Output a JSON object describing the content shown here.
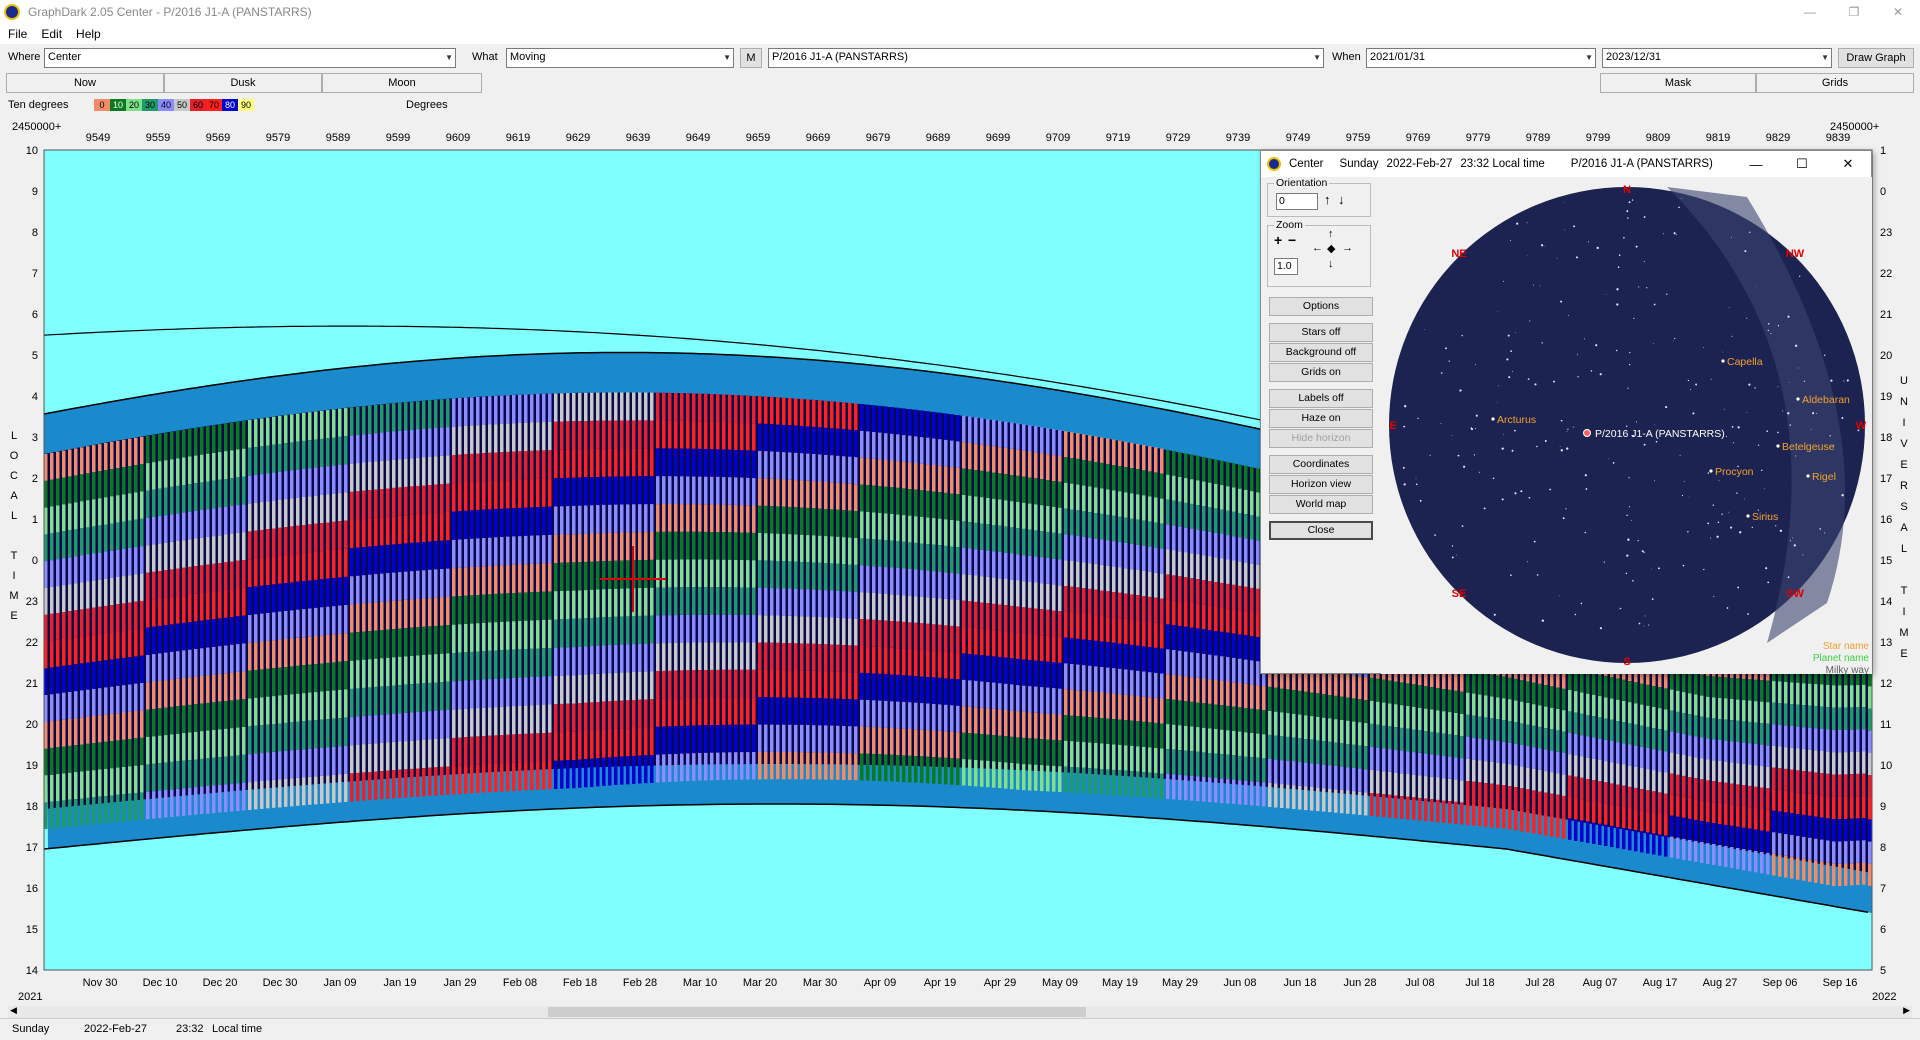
{
  "window": {
    "title": "GraphDark 2.05  Center  -  P/2016 J1-A (PANSTARRS)"
  },
  "menu": [
    "File",
    "Edit",
    "Help"
  ],
  "toolbar": {
    "where_label": "Where",
    "where_value": "Center",
    "what_label": "What",
    "what_value": "Moving",
    "m_button": "M",
    "object_value": "P/2016 J1-A (PANSTARRS)",
    "when_label": "When",
    "start_date": "2021/01/31",
    "end_date": "2023/12/31",
    "draw_button": "Draw Graph"
  },
  "tabs": {
    "now": "Now",
    "dusk": "Dusk",
    "moon": "Moon",
    "mask": "Mask",
    "grids": "Grids"
  },
  "legend": {
    "left_label": "Ten degrees",
    "right_label": "Degrees",
    "steps": [
      "0",
      "10",
      "20",
      "30",
      "40",
      "50",
      "60",
      "70",
      "80",
      "90"
    ],
    "colors": [
      "#f08c68",
      "#0a7a1e",
      "#7fe08a",
      "#1f9a6a",
      "#8a8cff",
      "#c8c8c8",
      "#e8202a",
      "#ff2020",
      "#0000d0",
      "#ffff80"
    ]
  },
  "graph": {
    "top_label": "2450000+",
    "right_label": "2450000+",
    "jd_ticks": [
      "9549",
      "9559",
      "9569",
      "9579",
      "9589",
      "9599",
      "9609",
      "9619",
      "9629",
      "9639",
      "9649",
      "9659",
      "9669",
      "9679",
      "9689",
      "9699",
      "9709",
      "9719",
      "9729",
      "9739",
      "9749",
      "9759",
      "9769",
      "9779",
      "9789",
      "9799",
      "9809",
      "9819",
      "9829",
      "9839"
    ],
    "date_ticks": [
      "Nov 30",
      "Dec 10",
      "Dec 20",
      "Dec 30",
      "Jan 09",
      "Jan 19",
      "Jan 29",
      "Feb 08",
      "Feb 18",
      "Feb 28",
      "Mar 10",
      "Mar 20",
      "Mar 30",
      "Apr 09",
      "Apr 19",
      "Apr 29",
      "May 09",
      "May 19",
      "May 29",
      "Jun 08",
      "Jun 18",
      "Jun 28",
      "Jul 08",
      "Jul 18",
      "Jul 28",
      "Aug 07",
      "Aug 17",
      "Aug 27",
      "Sep 06",
      "Sep 16"
    ],
    "left_hours": [
      "10",
      "9",
      "8",
      "7",
      "6",
      "5",
      "4",
      "3",
      "2",
      "1",
      "0",
      "23",
      "22",
      "21",
      "20",
      "19",
      "18",
      "17",
      "16",
      "15",
      "14"
    ],
    "right_hours": [
      "1",
      "0",
      "23",
      "22",
      "21",
      "20",
      "19",
      "18",
      "17",
      "16",
      "15",
      "14",
      "13",
      "12",
      "11",
      "10",
      "9",
      "8",
      "7",
      "6",
      "5"
    ],
    "left_axis_text": [
      "L",
      "O",
      "C",
      "A",
      "L",
      "",
      "T",
      "I",
      "M",
      "E"
    ],
    "right_axis_text": [
      "U",
      "N",
      "I",
      "V",
      "E",
      "R",
      "S",
      "A",
      "L",
      "",
      "T",
      "I",
      "M",
      "E"
    ],
    "year_left": "2021",
    "year_right": "2022",
    "colors": {
      "sky": "#80ffff",
      "night": "#08084a",
      "twilight": "#1a8acc"
    }
  },
  "status": {
    "day": "Sunday",
    "date": "2022-Feb-27",
    "time": "23:32",
    "zone": "Local time"
  },
  "sky_window": {
    "app": "Center",
    "day": "Sunday",
    "date": "2022-Feb-27",
    "time": "23:32 Local time",
    "object": "P/2016 J1-A (PANSTARRS)",
    "orientation_label": "Orientation",
    "orientation_value": "0",
    "zoom_label": "Zoom",
    "zoom_value": "1.0",
    "buttons": {
      "options": "Options",
      "stars": "Stars off",
      "background": "Background off",
      "grids": "Grids on",
      "labels": "Labels off",
      "haze": "Haze on",
      "hide_horizon": "Hide horizon",
      "coordinates": "Coordinates",
      "horizon_view": "Horizon view",
      "world_map": "World map",
      "close": "Close"
    },
    "compass": {
      "n": "N",
      "ne": "NE",
      "nw": "NW",
      "e": "E",
      "w": "W",
      "se": "SE",
      "sw": "SW",
      "s": "S"
    },
    "stars": [
      "Capella",
      "Aldebaran",
      "Arcturus",
      "Betelgeuse",
      "Procyon",
      "Rigel",
      "Sirius"
    ],
    "target_label": "P/2016 J1-A (PANSTARRS)",
    "legend": {
      "star": "Star name",
      "planet": "Planet name",
      "milky": "Milky way"
    }
  }
}
